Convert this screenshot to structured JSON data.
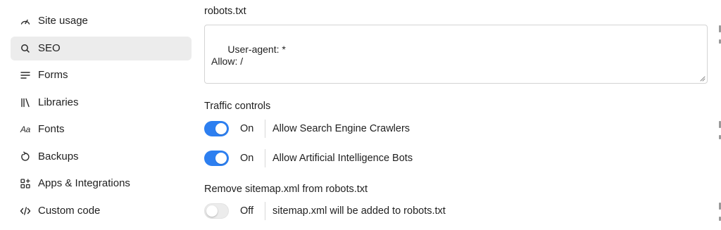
{
  "sidebar": {
    "items": [
      {
        "label": "Site usage",
        "icon": "gauge-icon",
        "active": false
      },
      {
        "label": "SEO",
        "icon": "search-icon",
        "active": true
      },
      {
        "label": "Forms",
        "icon": "lines-icon",
        "active": false
      },
      {
        "label": "Libraries",
        "icon": "library-icon",
        "active": false
      },
      {
        "label": "Fonts",
        "icon": "fonts-icon",
        "glyph": "Aa",
        "active": false
      },
      {
        "label": "Backups",
        "icon": "backup-icon",
        "active": false
      },
      {
        "label": "Apps & Integrations",
        "icon": "apps-icon",
        "active": false
      },
      {
        "label": "Custom code",
        "icon": "code-icon",
        "active": false
      }
    ]
  },
  "main": {
    "robots": {
      "label": "robots.txt",
      "content": "User-agent: *\nAllow: /"
    },
    "traffic": {
      "label": "Traffic controls",
      "toggles": [
        {
          "state": "On",
          "on": true,
          "description": "Allow Search Engine Crawlers"
        },
        {
          "state": "On",
          "on": true,
          "description": "Allow Artificial Intelligence Bots"
        }
      ]
    },
    "sitemap": {
      "label": "Remove sitemap.xml from robots.txt",
      "toggle": {
        "state": "Off",
        "on": false,
        "description": "sitemap.xml will be added to robots.txt"
      }
    }
  },
  "colors": {
    "accent": "#2d7ff0",
    "active_nav_bg": "#ececec",
    "border": "#d4d4d4"
  }
}
